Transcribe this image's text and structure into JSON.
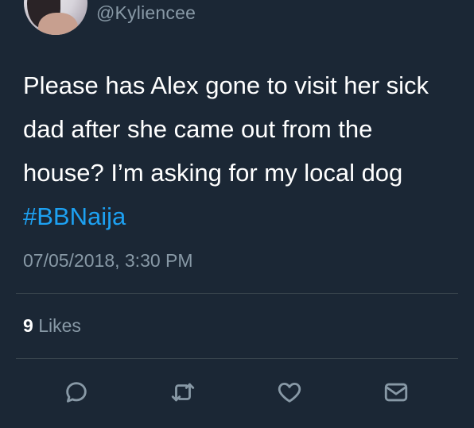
{
  "user": {
    "handle": "@Kyliencee"
  },
  "tweet": {
    "text": "Please has Alex gone to visit her sick dad after she came out from the house? I’m asking for my local dog ",
    "hashtag": "#BBNaija",
    "timestamp": "07/05/2018, 3:30 PM"
  },
  "stats": {
    "likes_count": "9",
    "likes_label": "Likes"
  },
  "actions": {
    "reply_icon": "reply-icon",
    "retweet_icon": "retweet-icon",
    "like_icon": "heart-icon",
    "message_icon": "envelope-icon"
  },
  "colors": {
    "background": "#1b2735",
    "text": "#ffffff",
    "muted": "#8899a6",
    "link": "#1da1f2",
    "divider": "#38444d"
  }
}
